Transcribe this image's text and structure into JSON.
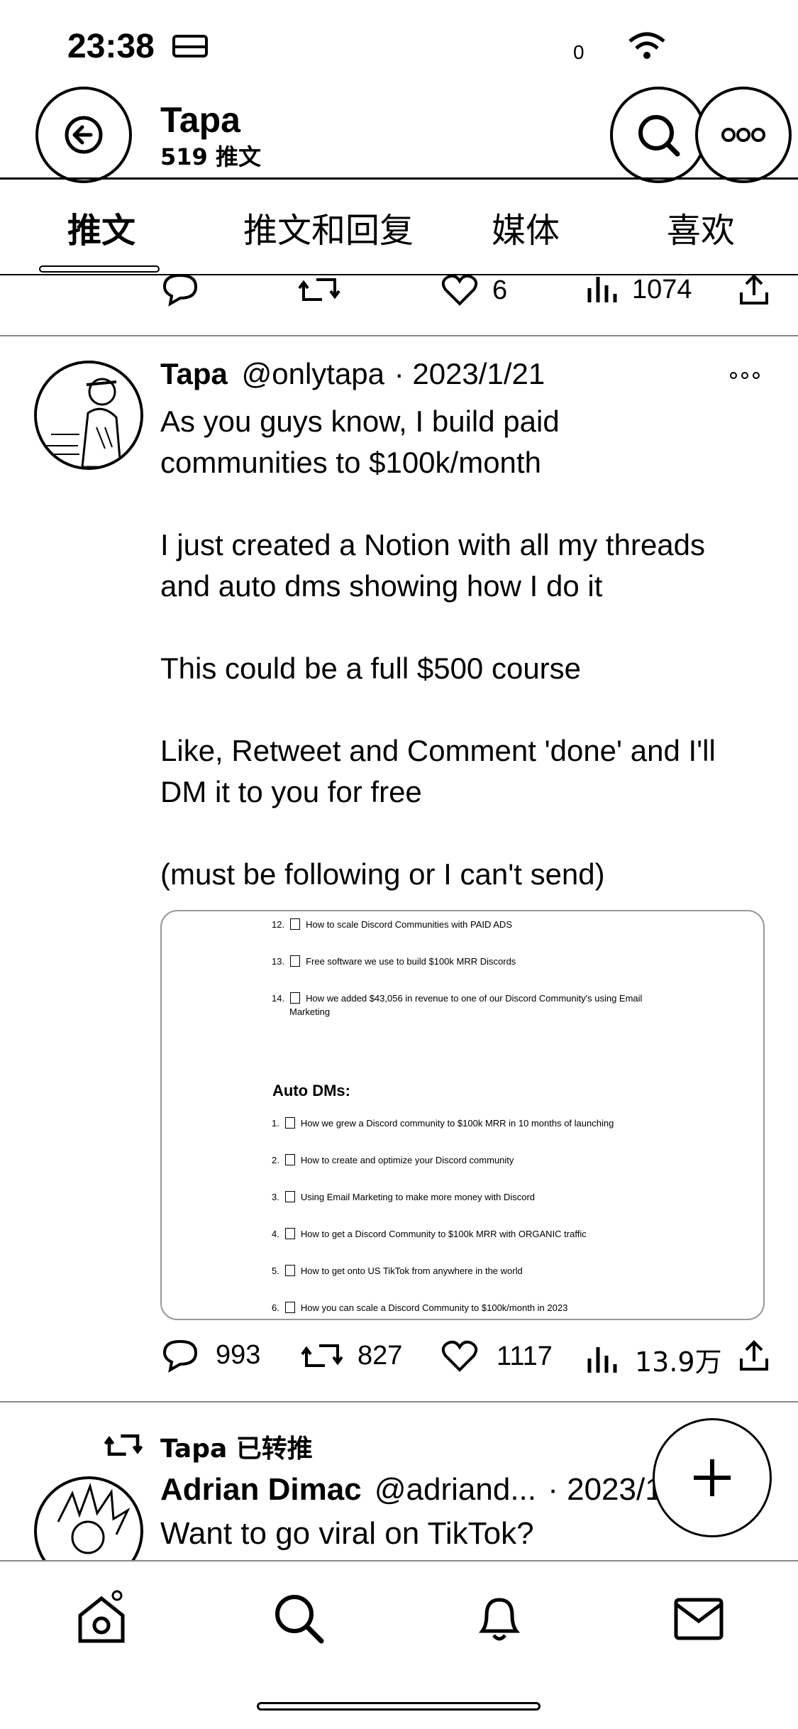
{
  "status_bar": {
    "time": "23:38",
    "signal_text": "0"
  },
  "header": {
    "name": "Tapa",
    "tweet_count": "519 推文",
    "back_icon": "arrow-left-icon",
    "search_icon": "search-icon",
    "more_icon": "more-icon"
  },
  "tabs": [
    {
      "label": "推文",
      "active": true
    },
    {
      "label": "推文和回复",
      "active": false
    },
    {
      "label": "媒体",
      "active": false
    },
    {
      "label": "喜欢",
      "active": false
    }
  ],
  "prev_tweet_actions": {
    "reply": "",
    "retweet": "",
    "likes": "6",
    "views": "1074"
  },
  "tweet": {
    "author": "Tapa",
    "handle": "@onlytapa",
    "date": "· 2023/1/21",
    "paragraphs": [
      [
        "As you guys know, I build paid",
        "communities to $100k/month"
      ],
      [
        "I just created a Notion with all my threads",
        "and auto dms showing how I do it"
      ],
      [
        "This could be a full $500 course"
      ],
      [
        "Like, Retweet and Comment 'done' and I'll",
        "DM it to you for free"
      ],
      [
        "(must be following or I can't send)"
      ]
    ],
    "embed": {
      "list_items": [
        {
          "n": "12.",
          "text": "How to scale Discord Communities with PAID ADS"
        },
        {
          "n": "13.",
          "text": "Free software we use to build $100k MRR Discords"
        },
        {
          "n": "14.",
          "text": "How we added $43,056 in revenue to one of our Discord Community's using Email",
          "text2": "Marketing"
        }
      ],
      "heading": "Auto DMs:",
      "dm_items": [
        {
          "n": "1.",
          "text": "How we grew a Discord community to $100k MRR in 10 months of launching"
        },
        {
          "n": "2.",
          "text": "How to create and optimize your Discord community"
        },
        {
          "n": "3.",
          "text": "Using Email Marketing to make more money with Discord"
        },
        {
          "n": "4.",
          "text": "How to get a Discord Community to $100k MRR with ORGANIC traffic"
        },
        {
          "n": "5.",
          "text": "How to get onto US TikTok from anywhere in the world"
        },
        {
          "n": "6.",
          "text": "How you can scale a Discord Community to $100k/month in 2023"
        }
      ]
    },
    "actions": {
      "replies": "993",
      "retweets": "827",
      "likes": "1117",
      "views": "13.9万"
    }
  },
  "retweet": {
    "label": "Tapa 已转推",
    "author": "Adrian Dimac",
    "handle": "@adriand...",
    "date": "· 2023/1/",
    "text": "Want to go viral on TikTok?"
  },
  "bottom_nav": [
    "home-icon",
    "search-icon",
    "bell-icon",
    "mail-icon"
  ]
}
